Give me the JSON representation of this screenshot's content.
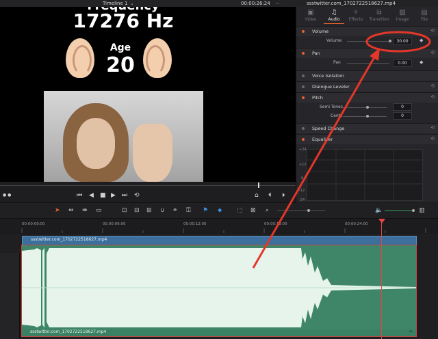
{
  "topbar": {
    "timeline_name": "Timeline 1",
    "timecode": "00:00:26:24",
    "filename": "ssstwitter.com_1702722518627.mp4"
  },
  "viewer": {
    "frequency_caption": "Frequency",
    "frequency": "17276 Hz",
    "age_label": "Age",
    "age_value": "20"
  },
  "inspector": {
    "tabs": [
      {
        "label": "Video",
        "icon": "video-icon"
      },
      {
        "label": "Audio",
        "icon": "music-note-icon"
      },
      {
        "label": "Effects",
        "icon": "effects-icon"
      },
      {
        "label": "Transition",
        "icon": "transition-icon"
      },
      {
        "label": "Image",
        "icon": "image-icon"
      },
      {
        "label": "File",
        "icon": "file-icon"
      }
    ],
    "active_tab": "Audio",
    "volume": {
      "title": "Volume",
      "param": "Volume",
      "value": "30.00"
    },
    "pan": {
      "title": "Pan",
      "param": "Pan",
      "value": "0.00"
    },
    "voice_isolation": {
      "title": "Voice Isolation"
    },
    "dialogue_leveler": {
      "title": "Dialogue Leveler"
    },
    "pitch": {
      "title": "Pitch",
      "semitones_label": "Semi Tones",
      "semitones_value": "0",
      "cents_label": "Cents",
      "cents_value": "0"
    },
    "speed_change": {
      "title": "Speed Change"
    },
    "equalizer": {
      "title": "Equalizer",
      "db_labels": [
        "+24",
        "+12",
        "0",
        "-12",
        "-24"
      ]
    }
  },
  "ruler": {
    "ticks": [
      "00:00:00:00",
      "00:00:06:00",
      "00:00:12:00",
      "00:00:18:00",
      "00:00:24:00"
    ]
  },
  "timeline": {
    "video_clip_name": "ssstwitter.com_1702722518627.mp4",
    "audio_clip_name": "ssstwitter.com_1702722518627.mp4"
  },
  "colors": {
    "accent": "#e8622c",
    "audio_clip": "#3e8667",
    "video_clip": "#3c6f9b",
    "playhead": "#e04646",
    "annotation": "#e3372a"
  }
}
